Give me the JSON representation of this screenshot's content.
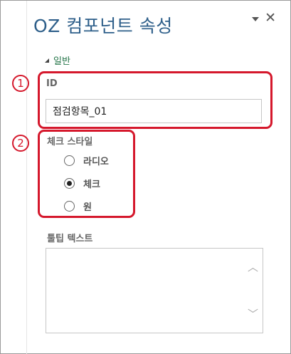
{
  "pane": {
    "title": "OZ 컴포넌트 속성",
    "dropdown_icon": "dropdown-arrow-icon",
    "close_glyph": "✕"
  },
  "section": {
    "label": "일반",
    "icon": "collapse-triangle-icon"
  },
  "id_field": {
    "label": "ID",
    "value": "점검항목_01"
  },
  "check_style": {
    "label": "체크 스타일",
    "options": [
      {
        "label": "라디오",
        "checked": false
      },
      {
        "label": "체크",
        "checked": true
      },
      {
        "label": "원",
        "checked": false
      }
    ]
  },
  "tooltip": {
    "label": "툴팁 텍스트",
    "value": "",
    "scroll_up": "︿",
    "scroll_down": "﹀"
  },
  "annotations": {
    "marker_1": "1",
    "marker_2": "2",
    "color": "#d5182c"
  },
  "colors": {
    "title": "#2e5f8a",
    "section": "#217346"
  }
}
